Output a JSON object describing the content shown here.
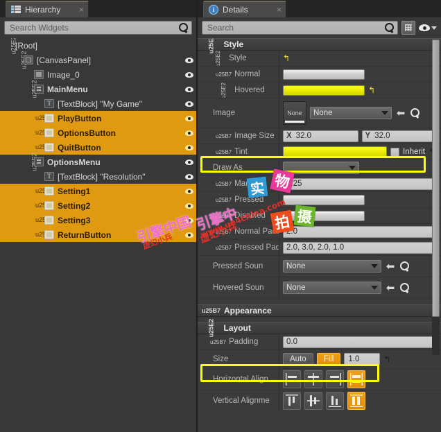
{
  "hierarchy": {
    "tab_label": "Hierarchy",
    "tab_icon": "hierarchy-icon",
    "close_label": "×",
    "search_placeholder": "Search Widgets",
    "rows": [
      {
        "label": "[Root]",
        "indent": 0,
        "twisty": "open",
        "icon": "none",
        "selected": false,
        "eye": false,
        "bold": false
      },
      {
        "label": "[CanvasPanel]",
        "indent": 1,
        "twisty": "open",
        "icon": "canvas",
        "selected": false,
        "eye": true,
        "bold": false
      },
      {
        "label": "Image_0",
        "indent": 2,
        "twisty": "none",
        "icon": "image",
        "selected": false,
        "eye": true,
        "bold": false
      },
      {
        "label": "MainMenu",
        "indent": 2,
        "twisty": "open",
        "icon": "vbox",
        "selected": false,
        "eye": true,
        "bold": true
      },
      {
        "label": "[TextBlock] \"My Game\"",
        "indent": 3,
        "twisty": "none",
        "icon": "text",
        "selected": false,
        "eye": true,
        "bold": false
      },
      {
        "label": "PlayButton",
        "indent": 3,
        "twisty": "closed",
        "icon": "button",
        "selected": true,
        "eye": true,
        "bold": true
      },
      {
        "label": "OptionsButton",
        "indent": 3,
        "twisty": "closed",
        "icon": "button",
        "selected": true,
        "eye": true,
        "bold": true
      },
      {
        "label": "QuitButton",
        "indent": 3,
        "twisty": "closed",
        "icon": "button",
        "selected": true,
        "eye": true,
        "bold": true
      },
      {
        "label": "OptionsMenu",
        "indent": 2,
        "twisty": "open",
        "icon": "vbox",
        "selected": false,
        "eye": true,
        "bold": true
      },
      {
        "label": "[TextBlock] \"Resolution\"",
        "indent": 3,
        "twisty": "none",
        "icon": "text",
        "selected": false,
        "eye": true,
        "bold": false
      },
      {
        "label": "Setting1",
        "indent": 3,
        "twisty": "closed",
        "icon": "button",
        "selected": true,
        "eye": true,
        "bold": true
      },
      {
        "label": "Setting2",
        "indent": 3,
        "twisty": "closed",
        "icon": "button",
        "selected": true,
        "eye": true,
        "bold": true
      },
      {
        "label": "Setting3",
        "indent": 3,
        "twisty": "closed",
        "icon": "button",
        "selected": true,
        "eye": true,
        "bold": true
      },
      {
        "label": "ReturnButton",
        "indent": 3,
        "twisty": "closed",
        "icon": "button",
        "selected": true,
        "eye": true,
        "bold": true
      }
    ]
  },
  "details": {
    "tab_label": "Details",
    "tab_icon": "details-info-icon",
    "close_label": "×",
    "search_placeholder": "Search",
    "toolbar": {
      "grid_view_icon": "grid-view-icon",
      "visibility_icon": "eye-icon",
      "visibility_caret": "chevron-down-icon"
    },
    "categories": {
      "style": "Style",
      "appearance": "Appearance",
      "layout": "Layout"
    },
    "rows": {
      "style_root": {
        "label": "Style"
      },
      "normal": {
        "label": "Normal"
      },
      "hovered": {
        "label": "Hovered"
      },
      "image": {
        "label": "Image",
        "thumb": "None",
        "value": "None"
      },
      "image_size": {
        "label": "Image Size",
        "x_axis": "X",
        "x": "32.0",
        "y_axis": "Y",
        "y": "32.0"
      },
      "tint": {
        "label": "Tint",
        "inherit": "Inherit"
      },
      "draw_as": {
        "label": "Draw As",
        "value": ""
      },
      "margin": {
        "label": "Margin",
        "value": "0.25"
      },
      "pressed": {
        "label": "Pressed"
      },
      "disabled": {
        "label": "Disabled"
      },
      "normal_padding": {
        "label": "Normal Paddi",
        "value": "2.0"
      },
      "pressed_padding": {
        "label": "Pressed Padd",
        "value": "2.0, 3.0, 2.0, 1.0"
      },
      "pressed_sound": {
        "label": "Pressed Soun",
        "value": "None"
      },
      "hovered_sound": {
        "label": "Hovered Soun",
        "value": "None"
      },
      "padding": {
        "label": "Padding",
        "value": "0.0"
      },
      "size": {
        "label": "Size",
        "auto": "Auto",
        "fill": "Fill",
        "value": "1.0"
      },
      "h_align": {
        "label": "Horizontal Align"
      },
      "v_align": {
        "label": "Vertical Alignme"
      }
    },
    "colors": {
      "highlight": "#ffff00",
      "hovered_brush": "#e8e800",
      "selection": "#e09a12",
      "accent_orange": "#f0a017"
    }
  },
  "watermarks": {
    "stamp_blue": "实",
    "stamp_pink": "物",
    "stamp_orange": "拍",
    "stamp_green": "摄",
    "text_left": "引擎中国",
    "text_right": "引擎中",
    "url": "www.ue4china.com",
    "red_cn": "虚幻小兵"
  }
}
